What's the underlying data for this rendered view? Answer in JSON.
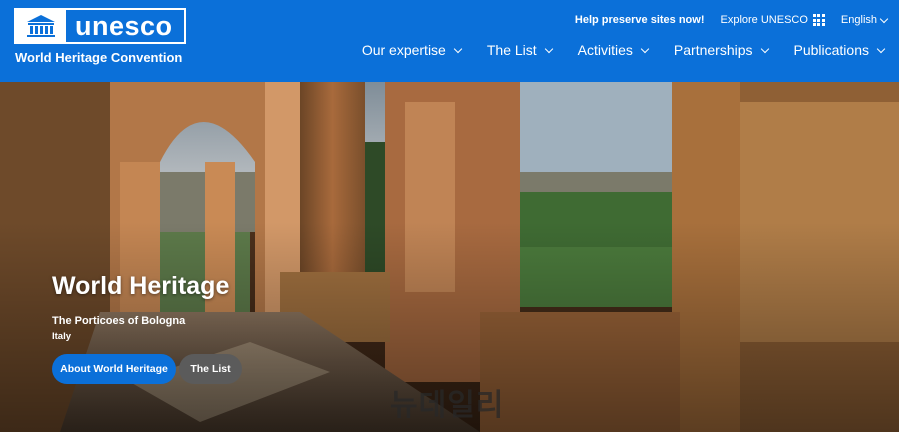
{
  "header": {
    "logo_word": "unesco",
    "convention": "World Heritage Convention",
    "top_links": {
      "help": "Help preserve sites now!",
      "explore": "Explore UNESCO",
      "language": "English"
    },
    "nav": [
      "Our expertise",
      "The List",
      "Activities",
      "Partnerships",
      "Publications"
    ]
  },
  "hero": {
    "title": "World Heritage",
    "subtitle": "The Porticoes of Bologna",
    "country": "Italy",
    "primary_button": "About World Heritage",
    "secondary_button": "The List",
    "watermark": "뉴데일리"
  },
  "colors": {
    "brand_blue": "#0b70d9",
    "secondary_button": "#5b5b5b"
  }
}
